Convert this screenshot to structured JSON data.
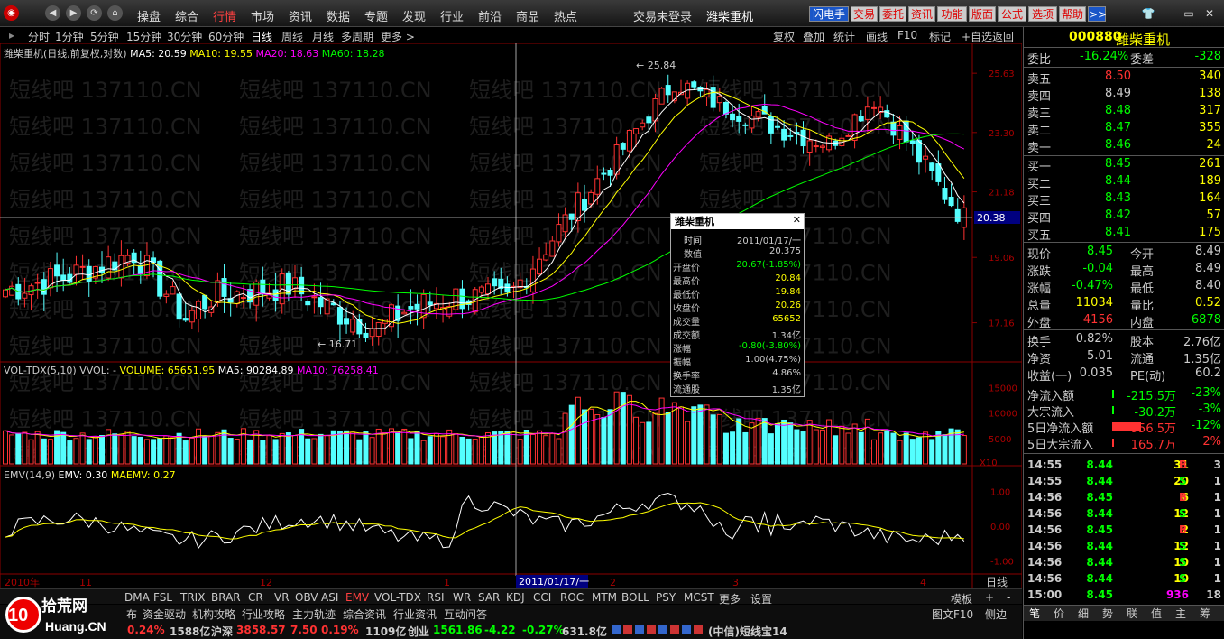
{
  "menu": {
    "items": [
      "操盘",
      "综合",
      "行情",
      "市场",
      "资讯",
      "数据",
      "专题",
      "发现",
      "行业",
      "前沿",
      "商品",
      "热点"
    ],
    "active_index": 2
  },
  "top": {
    "status": "交易未登录",
    "stock": "潍柴重机"
  },
  "toolbar": {
    "buttons": [
      "闪电手",
      "交易",
      "委托",
      "资讯",
      "功能",
      "版面",
      "公式",
      "选项",
      "帮助",
      ">>"
    ]
  },
  "periods": [
    "分时",
    "1分钟",
    "5分钟",
    "15分钟",
    "30分钟",
    "60分钟",
    "日线",
    "周线",
    "月线",
    "多周期",
    "更多 >"
  ],
  "period_selected": "日线",
  "chart_tools": [
    "复权",
    "叠加",
    "统计",
    "画线",
    "F10",
    "标记",
    "+自选",
    "返回"
  ],
  "main_legend": {
    "name": "潍柴重机(日线,前复权,对数)",
    "ma5": "MA5: 20.59",
    "ma10": "MA10: 19.55",
    "ma20": "MA20: 18.63",
    "ma60": "MA60: 18.28"
  },
  "price_axis": [
    "25.63",
    "23.30",
    "21.18",
    "19.06",
    "17.16"
  ],
  "price_marker": "20.38",
  "annotations": {
    "high": "25.84",
    "low": "16.71"
  },
  "vol_legend": {
    "name": "VOL-TDX(5,10)",
    "vvol": "VVOL: -",
    "volume": "VOLUME: 65651.95",
    "ma5": "MA5: 90284.89",
    "ma10": "MA10: 76258.41"
  },
  "vol_axis": [
    "15000",
    "10000",
    "5000",
    "X10"
  ],
  "emv_legend": {
    "name": "EMV(14,9)",
    "emv": "EMV: 0.30",
    "maemv": "MAEMV: 0.27"
  },
  "emv_axis": [
    "1.00",
    "0.00",
    "-1.00"
  ],
  "xaxis": {
    "labels": [
      "2010年",
      "11",
      "12",
      "1",
      "2",
      "3",
      "4"
    ],
    "cursor": "2011/01/17/一",
    "corner": "日线"
  },
  "popup": {
    "title": "潍柴重机",
    "rows": [
      {
        "label": "时间",
        "value": "2011/01/17/一"
      },
      {
        "label": "数值",
        "value": "20.375"
      },
      {
        "label": "开盘价",
        "value": "20.67(-1.85%)"
      },
      {
        "label": "最高价",
        "value": "20.84"
      },
      {
        "label": "最低价",
        "value": "19.84"
      },
      {
        "label": "收盘价",
        "value": "20.26"
      },
      {
        "label": "成交量",
        "value": "65652"
      },
      {
        "label": "成交额",
        "value": "1.34亿"
      },
      {
        "label": "涨幅",
        "value": "-0.80(-3.80%)"
      },
      {
        "label": "振幅",
        "value": "1.00(4.75%)"
      },
      {
        "label": "换手率",
        "value": "4.86%"
      },
      {
        "label": "流通股",
        "value": "1.35亿"
      }
    ]
  },
  "indicators": [
    "DMA",
    "FSL",
    "TRIX",
    "BRAR",
    "CR",
    "VR",
    "OBV",
    "ASI",
    "EMV",
    "VOL-TDX",
    "RSI",
    "WR",
    "SAR",
    "KDJ",
    "CCI",
    "ROC",
    "MTM",
    "BOLL",
    "PSY",
    "MCST",
    "更多",
    "设置"
  ],
  "indicator_selected": "EMV",
  "indicator_right": {
    "template": "模板",
    "plus": "+",
    "minus": "-"
  },
  "watermark": "短线吧 137110.CN",
  "logo": {
    "number": "10",
    "text1": "拾荒网",
    "text2": "Huang.CN"
  },
  "bottom_row1": {
    "links": [
      "资金驱动",
      "机构攻略",
      "行业攻略",
      "主力轨迹",
      "综合资讯",
      "行业资讯",
      "互动问答"
    ],
    "prefix": "布",
    "right1": "图文F10",
    "right2": "侧边"
  },
  "bottom_row2": {
    "pct1": "0.24%",
    "amt1": "1588亿",
    "hushen_label": "沪深",
    "hushen_val": "3858.57",
    "hushen_chg": "7.50",
    "hushen_pct": "0.19%",
    "hushen_amt": "1109亿",
    "cy_label": "创业",
    "cy_val": "1561.86",
    "cy_chg": "-4.22",
    "cy_pct": "-0.27%",
    "cy_amt": "631.8亿",
    "source": "(中信)短线宝14"
  },
  "quote": {
    "code": "000880",
    "name": "潍柴重机",
    "weibi_label": "委比",
    "weibi": "-16.24%",
    "weicha_label": "委差",
    "weicha": "-328",
    "asks": [
      {
        "label": "卖五",
        "price": "8.50",
        "vol": "340"
      },
      {
        "label": "卖四",
        "price": "8.49",
        "vol": "138"
      },
      {
        "label": "卖三",
        "price": "8.48",
        "vol": "317"
      },
      {
        "label": "卖二",
        "price": "8.47",
        "vol": "355"
      },
      {
        "label": "卖一",
        "price": "8.46",
        "vol": "24"
      }
    ],
    "bids": [
      {
        "label": "买一",
        "price": "8.45",
        "vol": "261"
      },
      {
        "label": "买二",
        "price": "8.44",
        "vol": "189"
      },
      {
        "label": "买三",
        "price": "8.43",
        "vol": "164"
      },
      {
        "label": "买四",
        "price": "8.42",
        "vol": "57"
      },
      {
        "label": "买五",
        "price": "8.41",
        "vol": "175"
      }
    ],
    "stats": [
      {
        "l1": "现价",
        "v1": "8.45",
        "l2": "今开",
        "v2": "8.49"
      },
      {
        "l1": "涨跌",
        "v1": "-0.04",
        "l2": "最高",
        "v2": "8.49"
      },
      {
        "l1": "涨幅",
        "v1": "-0.47%",
        "l2": "最低",
        "v2": "8.40"
      },
      {
        "l1": "总量",
        "v1": "11034",
        "l2": "量比",
        "v2": "0.52"
      },
      {
        "l1": "外盘",
        "v1": "4156",
        "l2": "内盘",
        "v2": "6878"
      }
    ],
    "stats2": [
      {
        "l1": "换手",
        "v1": "0.82%",
        "l2": "股本",
        "v2": "2.76亿"
      },
      {
        "l1": "净资",
        "v1": "5.01",
        "l2": "流通",
        "v2": "1.35亿"
      },
      {
        "l1": "收益(一)",
        "v1": "0.035",
        "l2": "PE(动)",
        "v2": "60.2"
      }
    ],
    "flows": [
      {
        "label": "净流入额",
        "value": "-215.5万",
        "pct": "-23%",
        "bar": 0.02
      },
      {
        "label": "大宗流入",
        "value": "-30.2万",
        "pct": "-3%",
        "bar": 0.01
      },
      {
        "label": "5日净流入额",
        "value": "956.5万",
        "pct": "-12%",
        "bar": 0.8
      },
      {
        "label": "5日大宗流入",
        "value": "165.7万",
        "pct": "2%",
        "bar": 0.03
      }
    ],
    "ticks": [
      {
        "t": "14:55",
        "p": "8.44",
        "v": "31",
        "bs": "B",
        "n": "3"
      },
      {
        "t": "14:55",
        "p": "8.44",
        "v": "20",
        "bs": "S",
        "n": "1"
      },
      {
        "t": "14:56",
        "p": "8.45",
        "v": "6",
        "bs": "B",
        "n": "1"
      },
      {
        "t": "14:56",
        "p": "8.44",
        "v": "12",
        "bs": "S",
        "n": "1"
      },
      {
        "t": "14:56",
        "p": "8.45",
        "v": "2",
        "bs": "B",
        "n": "1"
      },
      {
        "t": "14:56",
        "p": "8.44",
        "v": "12",
        "bs": "S",
        "n": "1"
      },
      {
        "t": "14:56",
        "p": "8.44",
        "v": "10",
        "bs": "S",
        "n": "1"
      },
      {
        "t": "14:56",
        "p": "8.44",
        "v": "10",
        "bs": "S",
        "n": "1"
      },
      {
        "t": "15:00",
        "p": "8.45",
        "v": "936",
        "bs": "",
        "n": "18"
      }
    ],
    "tabs": [
      "笔",
      "价",
      "细",
      "势",
      "联",
      "值",
      "主",
      "筹"
    ]
  },
  "colors": {
    "up": "#ff3232",
    "down": "#54ffff",
    "ma5": "#ffffff",
    "ma10": "#ffff00",
    "ma20": "#ff00ff",
    "ma60": "#00ff00",
    "accent": "#ffff00"
  }
}
